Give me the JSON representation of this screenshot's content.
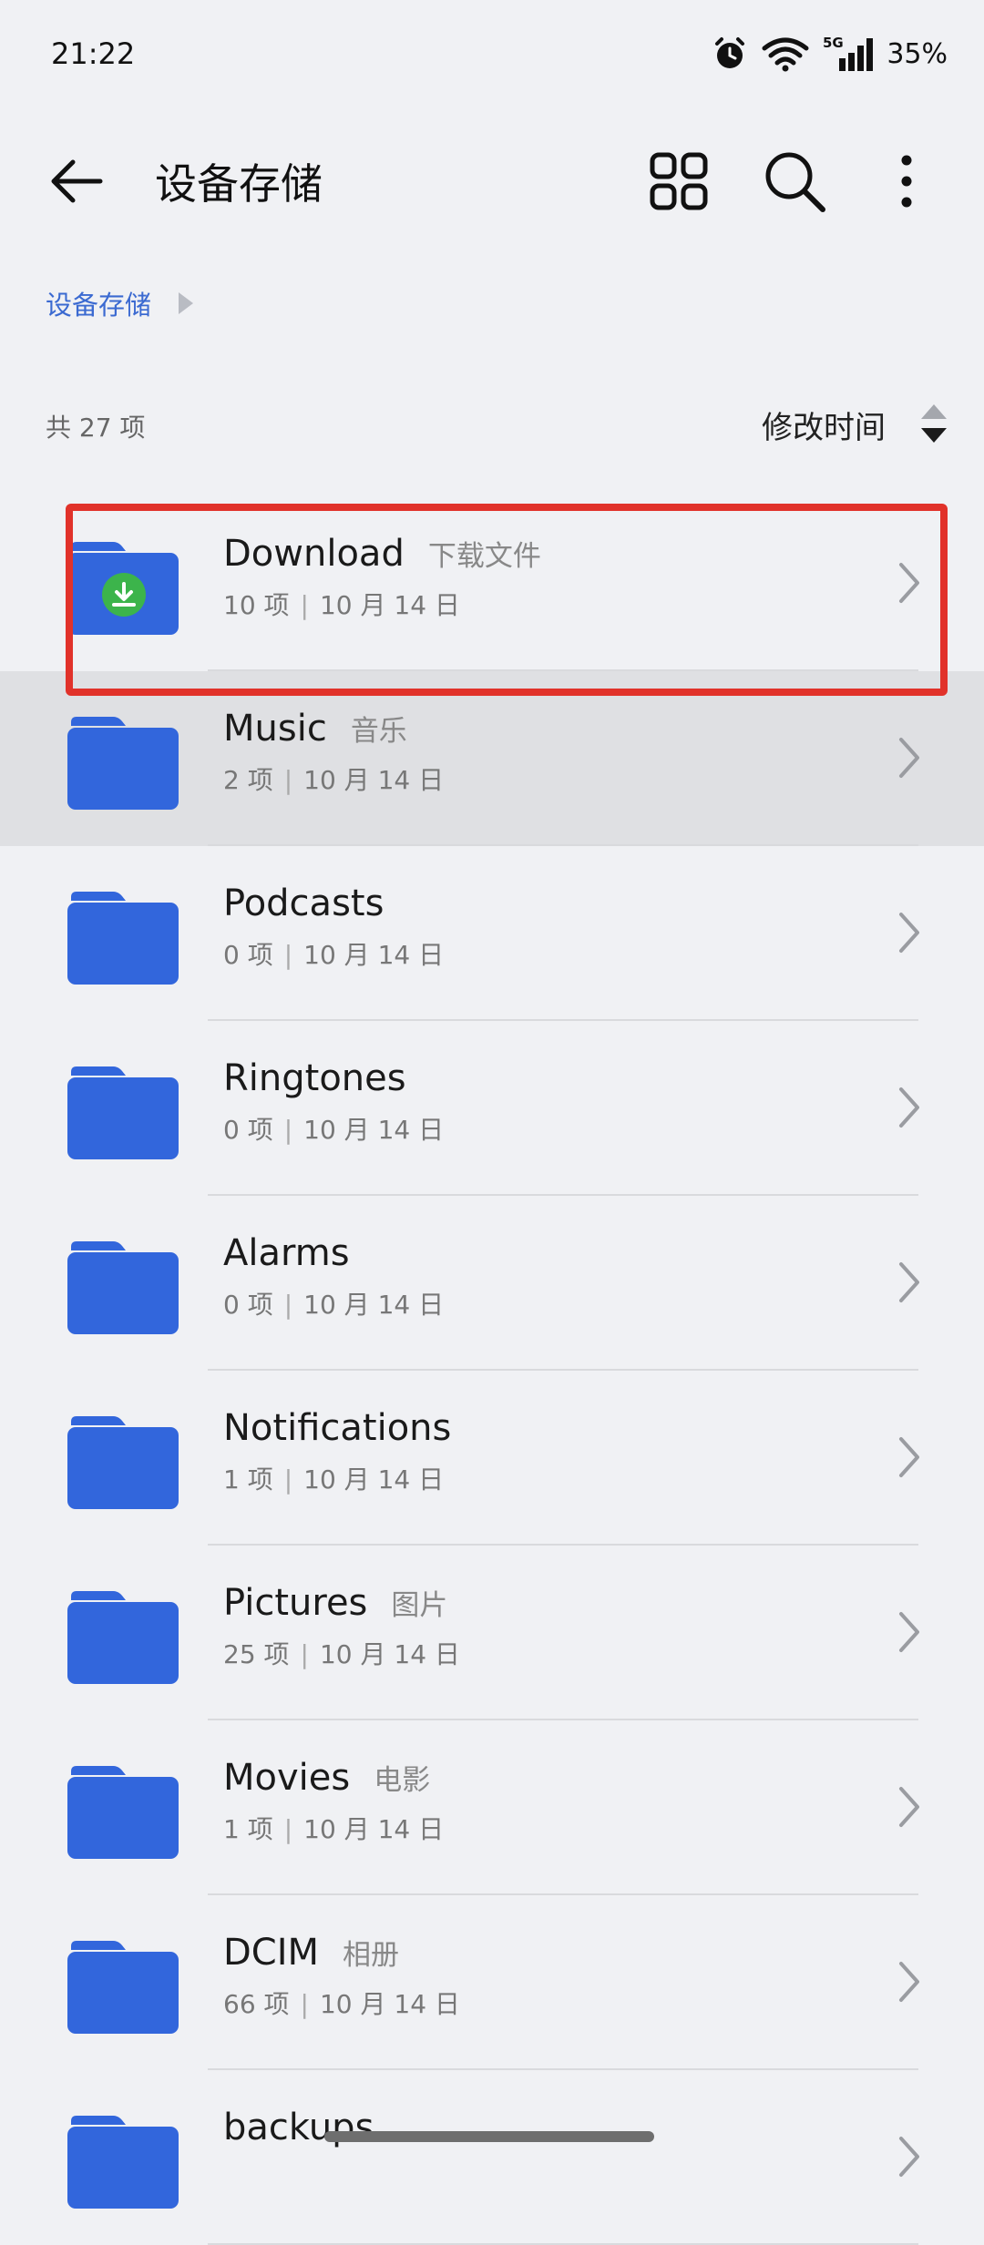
{
  "status_bar": {
    "time": "21:22",
    "network": "5G",
    "battery": "35%"
  },
  "toolbar": {
    "title": "设备存储"
  },
  "breadcrumb": {
    "items": [
      "设备存储"
    ]
  },
  "list_header": {
    "count": "共 27 项",
    "sort_label": "修改时间"
  },
  "folders": [
    {
      "name": "Download",
      "alias": "下载文件",
      "count": "10 项",
      "date": "10 月 14 日",
      "badge": "download-icon"
    },
    {
      "name": "Music",
      "alias": "音乐",
      "count": "2 项",
      "date": "10 月 14 日"
    },
    {
      "name": "Podcasts",
      "alias": "",
      "count": "0 项",
      "date": "10 月 14 日"
    },
    {
      "name": "Ringtones",
      "alias": "",
      "count": "0 项",
      "date": "10 月 14 日"
    },
    {
      "name": "Alarms",
      "alias": "",
      "count": "0 项",
      "date": "10 月 14 日"
    },
    {
      "name": "Notifications",
      "alias": "",
      "count": "1 项",
      "date": "10 月 14 日"
    },
    {
      "name": "Pictures",
      "alias": "图片",
      "count": "25 项",
      "date": "10 月 14 日"
    },
    {
      "name": "Movies",
      "alias": "电影",
      "count": "1 项",
      "date": "10 月 14 日"
    },
    {
      "name": "DCIM",
      "alias": "相册",
      "count": "66 项",
      "date": "10 月 14 日"
    },
    {
      "name": "backups",
      "alias": "",
      "count": "",
      "date": ""
    }
  ],
  "colors": {
    "folder": "#3266dc",
    "accent": "#3b6ad1",
    "highlight": "#e1322a",
    "badge": "#3cb44b"
  }
}
